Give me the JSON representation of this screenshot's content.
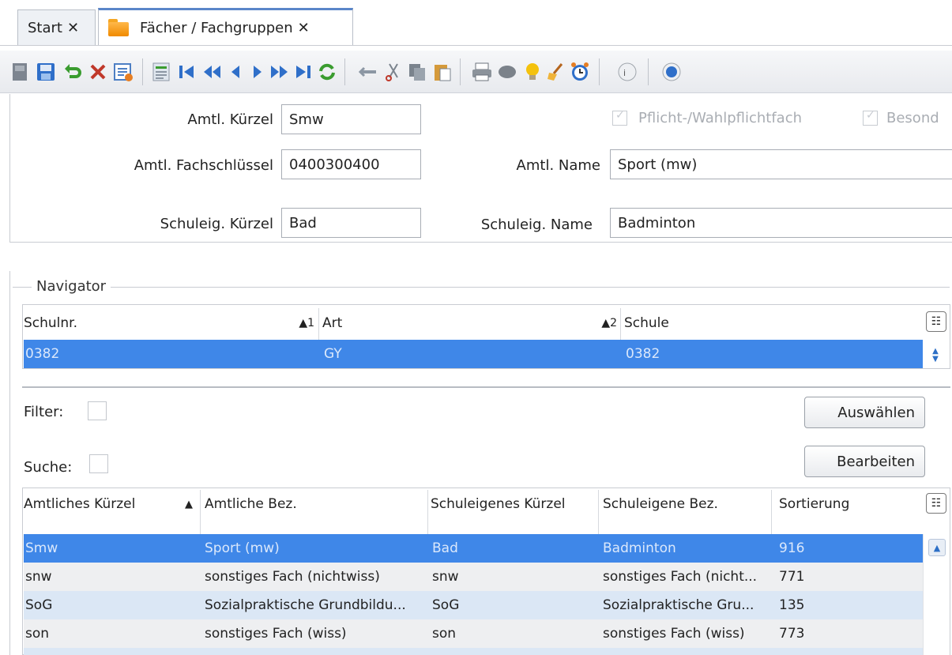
{
  "tabs": [
    {
      "label": "Start",
      "close": "✕"
    },
    {
      "label": "Fächer / Fachgruppen",
      "close": "✕"
    }
  ],
  "toolbar": {
    "icons": [
      "first-record-icon",
      "save-icon",
      "undo-icon",
      "delete-icon",
      "list-icon",
      "report-icon",
      "first-icon",
      "rewind-icon",
      "prev-icon",
      "next-icon",
      "fast-forward-icon",
      "last-icon",
      "refresh-icon",
      "back-arrow-icon",
      "cut-icon",
      "copy-icon",
      "paste-icon",
      "print-icon",
      "settings-icon",
      "hint-icon",
      "broom-icon",
      "alarm-icon",
      "info-icon",
      "help-icon"
    ]
  },
  "form": {
    "amtl_kuerzel_label": "Amtl. Kürzel",
    "amtl_kuerzel_value": "Smw",
    "pflicht_label": "Pflicht-/Wahlpflichtfach",
    "besond_label": "Besond",
    "fachschluessel_label": "Amtl.  Fachschlüssel",
    "fachschluessel_value": "0400300400",
    "amtl_name_label": "Amtl. Name",
    "amtl_name_value": "Sport (mw)",
    "schuleig_kuerzel_label": "Schuleig. Kürzel",
    "schuleig_kuerzel_value": "Bad",
    "schuleig_name_label": "Schuleig. Name",
    "schuleig_name_value": "Badminton"
  },
  "navigator": {
    "title": "Navigator",
    "columns": [
      {
        "label": "Schulnr.",
        "sort": "▲1"
      },
      {
        "label": "Art",
        "sort": "▲2"
      },
      {
        "label": "Schule",
        "sort": ""
      }
    ],
    "selected_row": [
      "0382",
      "GY",
      "0382"
    ],
    "filter_label": "Filter:",
    "search_label": "Suche:",
    "select_button": "Auswählen",
    "edit_button": "Bearbeiten"
  },
  "table": {
    "columns": [
      {
        "label": "Amtliches Kürzel",
        "sort": "▲"
      },
      {
        "label": "Amtliche Bez.",
        "sort": ""
      },
      {
        "label": "Schuleigenes Kürzel",
        "sort": ""
      },
      {
        "label": "Schuleigene Bez.",
        "sort": ""
      },
      {
        "label": "Sortierung",
        "sort": ""
      }
    ],
    "rows": [
      [
        "Smw",
        "Sport (mw)",
        "Bad",
        "Badminton",
        "916"
      ],
      [
        "snw",
        "sonstiges Fach (nichtwiss)",
        "snw",
        "sonstiges Fach (nicht...",
        "771"
      ],
      [
        "SoG",
        "Sozialpraktische Grundbildu...",
        "SoG",
        "Sozialpraktische Gru...",
        "135"
      ],
      [
        "son",
        "sonstiges Fach (wiss)",
        "son",
        "sonstiges Fach (wiss)",
        "773"
      ]
    ]
  },
  "colors": {
    "selection": "#3f87e8",
    "row_alt": "#dbe7f5",
    "row_gray": "#eeeff1",
    "accent": "#5b86c9"
  }
}
